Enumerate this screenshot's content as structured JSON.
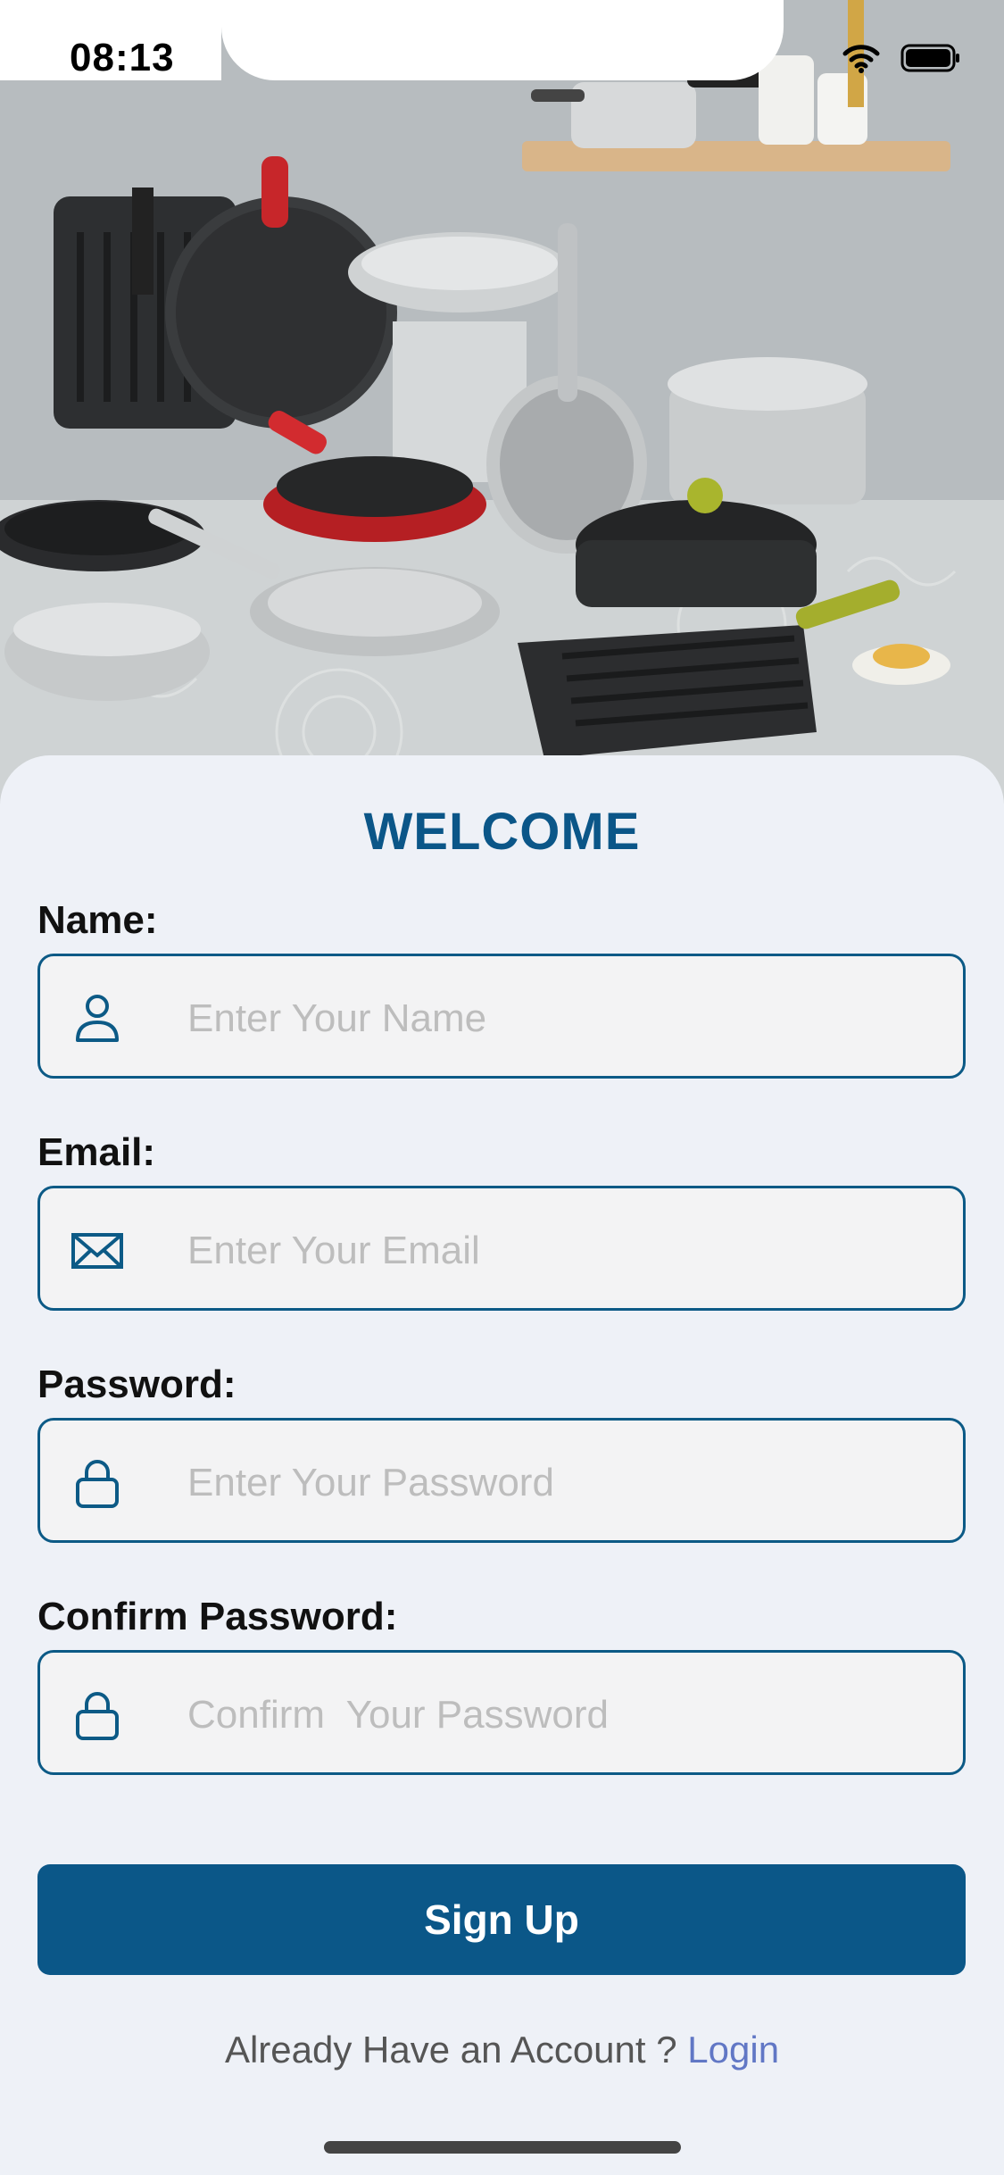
{
  "status_bar": {
    "time": "08:13"
  },
  "hero": {
    "image_name": "cookware-product-photo"
  },
  "form": {
    "title": "WELCOME",
    "fields": [
      {
        "label": "Name:",
        "placeholder": "Enter Your Name",
        "icon": "person-icon"
      },
      {
        "label": "Email:",
        "placeholder": "Enter Your Email",
        "icon": "envelope-icon"
      },
      {
        "label": "Password:",
        "placeholder": "Enter Your Password",
        "icon": "lock-icon"
      },
      {
        "label": "Confirm Password:",
        "placeholder": "Confirm  Your Password",
        "icon": "lock-icon"
      }
    ],
    "submit_label": "Sign Up",
    "footer_text": "Already Have an Account ? ",
    "footer_link": "Login"
  },
  "colors": {
    "accent": "#0b5788",
    "sheet_background": "#eef1f7",
    "field_background": "#f3f3f4",
    "link": "#6177c5"
  }
}
